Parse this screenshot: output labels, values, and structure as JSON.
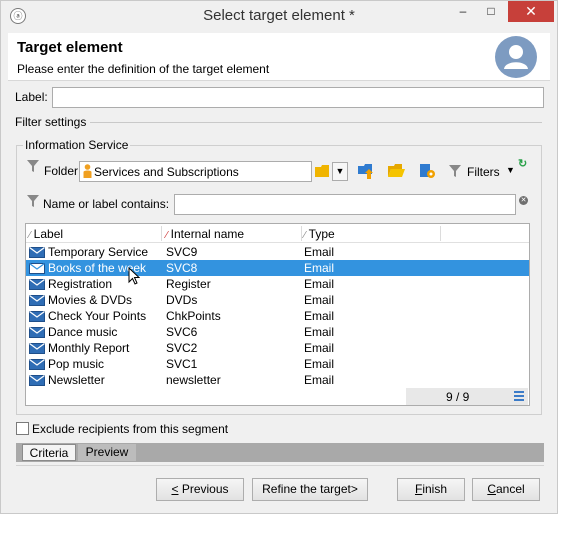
{
  "window": {
    "title": "Select target element *",
    "minimize_glyph": "–",
    "maximize_glyph": "□",
    "close_glyph": "✕"
  },
  "header": {
    "title": "Target element",
    "subtitle": "Please enter the definition of the target element"
  },
  "label_field": {
    "label": "Label:",
    "value": ""
  },
  "filter_settings": {
    "title": "Filter settings"
  },
  "information_service": {
    "title": "Information Service",
    "folder_label": "Folder:",
    "folder_value": "Services and Subscriptions",
    "filters_label": "Filters",
    "name_filter_label": "Name or label contains:",
    "name_filter_value": ""
  },
  "list": {
    "columns": [
      "Label",
      "Internal name",
      "Type"
    ],
    "rows": [
      {
        "label": "Temporary Service",
        "internal": "SVC9",
        "type": "Email",
        "selected": false
      },
      {
        "label": "Books of the week",
        "internal": "SVC8",
        "type": "Email",
        "selected": true
      },
      {
        "label": "Registration",
        "internal": "Register",
        "type": "Email",
        "selected": false
      },
      {
        "label": "Movies & DVDs",
        "internal": "DVDs",
        "type": "Email",
        "selected": false
      },
      {
        "label": "Check Your Points",
        "internal": "ChkPoints",
        "type": "Email",
        "selected": false
      },
      {
        "label": "Dance music",
        "internal": "SVC6",
        "type": "Email",
        "selected": false
      },
      {
        "label": "Monthly Report",
        "internal": "SVC2",
        "type": "Email",
        "selected": false
      },
      {
        "label": "Pop music",
        "internal": "SVC1",
        "type": "Email",
        "selected": false
      },
      {
        "label": "Newsletter",
        "internal": "newsletter",
        "type": "Email",
        "selected": false
      }
    ],
    "count": "9 / 9"
  },
  "exclude_checkbox": {
    "label": "Exclude recipients from this segment",
    "checked": false
  },
  "tabs": {
    "criteria": "Criteria",
    "preview": "Preview"
  },
  "buttons": {
    "previous_mnemonic": "<",
    "previous_rest": " Previous",
    "refine": "Refine the target>",
    "finish_mnemonic": "F",
    "finish_rest": "inish",
    "cancel_mnemonic": "C",
    "cancel_rest": "ancel"
  },
  "colors": {
    "selection": "#3393df",
    "close_button": "#c7403a",
    "avatar": "#7d9bc1",
    "folder_icon": "#f0b400",
    "mail_icon": "#2f6db5"
  }
}
